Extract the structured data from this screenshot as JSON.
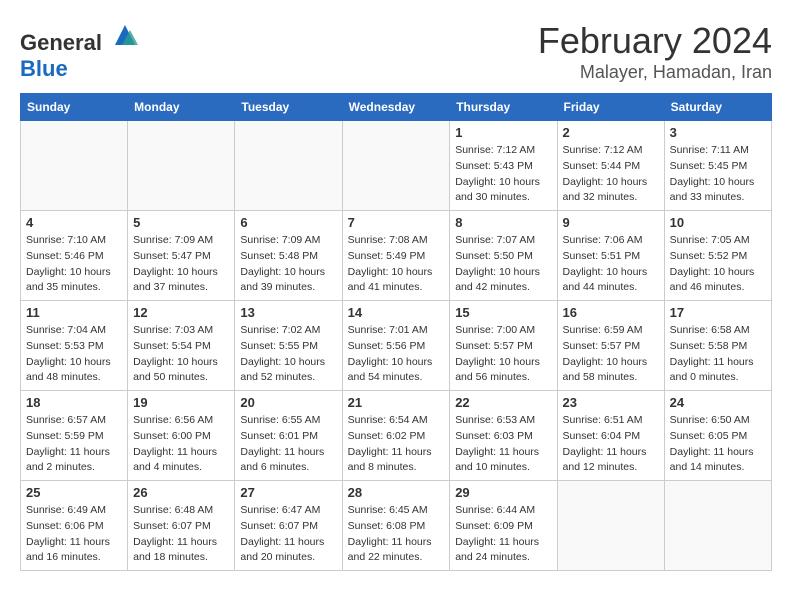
{
  "header": {
    "logo_general": "General",
    "logo_blue": "Blue",
    "month_title": "February 2024",
    "location": "Malayer, Hamadan, Iran"
  },
  "weekdays": [
    "Sunday",
    "Monday",
    "Tuesday",
    "Wednesday",
    "Thursday",
    "Friday",
    "Saturday"
  ],
  "weeks": [
    [
      {
        "day": "",
        "info": ""
      },
      {
        "day": "",
        "info": ""
      },
      {
        "day": "",
        "info": ""
      },
      {
        "day": "",
        "info": ""
      },
      {
        "day": "1",
        "info": "Sunrise: 7:12 AM\nSunset: 5:43 PM\nDaylight: 10 hours\nand 30 minutes."
      },
      {
        "day": "2",
        "info": "Sunrise: 7:12 AM\nSunset: 5:44 PM\nDaylight: 10 hours\nand 32 minutes."
      },
      {
        "day": "3",
        "info": "Sunrise: 7:11 AM\nSunset: 5:45 PM\nDaylight: 10 hours\nand 33 minutes."
      }
    ],
    [
      {
        "day": "4",
        "info": "Sunrise: 7:10 AM\nSunset: 5:46 PM\nDaylight: 10 hours\nand 35 minutes."
      },
      {
        "day": "5",
        "info": "Sunrise: 7:09 AM\nSunset: 5:47 PM\nDaylight: 10 hours\nand 37 minutes."
      },
      {
        "day": "6",
        "info": "Sunrise: 7:09 AM\nSunset: 5:48 PM\nDaylight: 10 hours\nand 39 minutes."
      },
      {
        "day": "7",
        "info": "Sunrise: 7:08 AM\nSunset: 5:49 PM\nDaylight: 10 hours\nand 41 minutes."
      },
      {
        "day": "8",
        "info": "Sunrise: 7:07 AM\nSunset: 5:50 PM\nDaylight: 10 hours\nand 42 minutes."
      },
      {
        "day": "9",
        "info": "Sunrise: 7:06 AM\nSunset: 5:51 PM\nDaylight: 10 hours\nand 44 minutes."
      },
      {
        "day": "10",
        "info": "Sunrise: 7:05 AM\nSunset: 5:52 PM\nDaylight: 10 hours\nand 46 minutes."
      }
    ],
    [
      {
        "day": "11",
        "info": "Sunrise: 7:04 AM\nSunset: 5:53 PM\nDaylight: 10 hours\nand 48 minutes."
      },
      {
        "day": "12",
        "info": "Sunrise: 7:03 AM\nSunset: 5:54 PM\nDaylight: 10 hours\nand 50 minutes."
      },
      {
        "day": "13",
        "info": "Sunrise: 7:02 AM\nSunset: 5:55 PM\nDaylight: 10 hours\nand 52 minutes."
      },
      {
        "day": "14",
        "info": "Sunrise: 7:01 AM\nSunset: 5:56 PM\nDaylight: 10 hours\nand 54 minutes."
      },
      {
        "day": "15",
        "info": "Sunrise: 7:00 AM\nSunset: 5:57 PM\nDaylight: 10 hours\nand 56 minutes."
      },
      {
        "day": "16",
        "info": "Sunrise: 6:59 AM\nSunset: 5:57 PM\nDaylight: 10 hours\nand 58 minutes."
      },
      {
        "day": "17",
        "info": "Sunrise: 6:58 AM\nSunset: 5:58 PM\nDaylight: 11 hours\nand 0 minutes."
      }
    ],
    [
      {
        "day": "18",
        "info": "Sunrise: 6:57 AM\nSunset: 5:59 PM\nDaylight: 11 hours\nand 2 minutes."
      },
      {
        "day": "19",
        "info": "Sunrise: 6:56 AM\nSunset: 6:00 PM\nDaylight: 11 hours\nand 4 minutes."
      },
      {
        "day": "20",
        "info": "Sunrise: 6:55 AM\nSunset: 6:01 PM\nDaylight: 11 hours\nand 6 minutes."
      },
      {
        "day": "21",
        "info": "Sunrise: 6:54 AM\nSunset: 6:02 PM\nDaylight: 11 hours\nand 8 minutes."
      },
      {
        "day": "22",
        "info": "Sunrise: 6:53 AM\nSunset: 6:03 PM\nDaylight: 11 hours\nand 10 minutes."
      },
      {
        "day": "23",
        "info": "Sunrise: 6:51 AM\nSunset: 6:04 PM\nDaylight: 11 hours\nand 12 minutes."
      },
      {
        "day": "24",
        "info": "Sunrise: 6:50 AM\nSunset: 6:05 PM\nDaylight: 11 hours\nand 14 minutes."
      }
    ],
    [
      {
        "day": "25",
        "info": "Sunrise: 6:49 AM\nSunset: 6:06 PM\nDaylight: 11 hours\nand 16 minutes."
      },
      {
        "day": "26",
        "info": "Sunrise: 6:48 AM\nSunset: 6:07 PM\nDaylight: 11 hours\nand 18 minutes."
      },
      {
        "day": "27",
        "info": "Sunrise: 6:47 AM\nSunset: 6:07 PM\nDaylight: 11 hours\nand 20 minutes."
      },
      {
        "day": "28",
        "info": "Sunrise: 6:45 AM\nSunset: 6:08 PM\nDaylight: 11 hours\nand 22 minutes."
      },
      {
        "day": "29",
        "info": "Sunrise: 6:44 AM\nSunset: 6:09 PM\nDaylight: 11 hours\nand 24 minutes."
      },
      {
        "day": "",
        "info": ""
      },
      {
        "day": "",
        "info": ""
      }
    ]
  ]
}
